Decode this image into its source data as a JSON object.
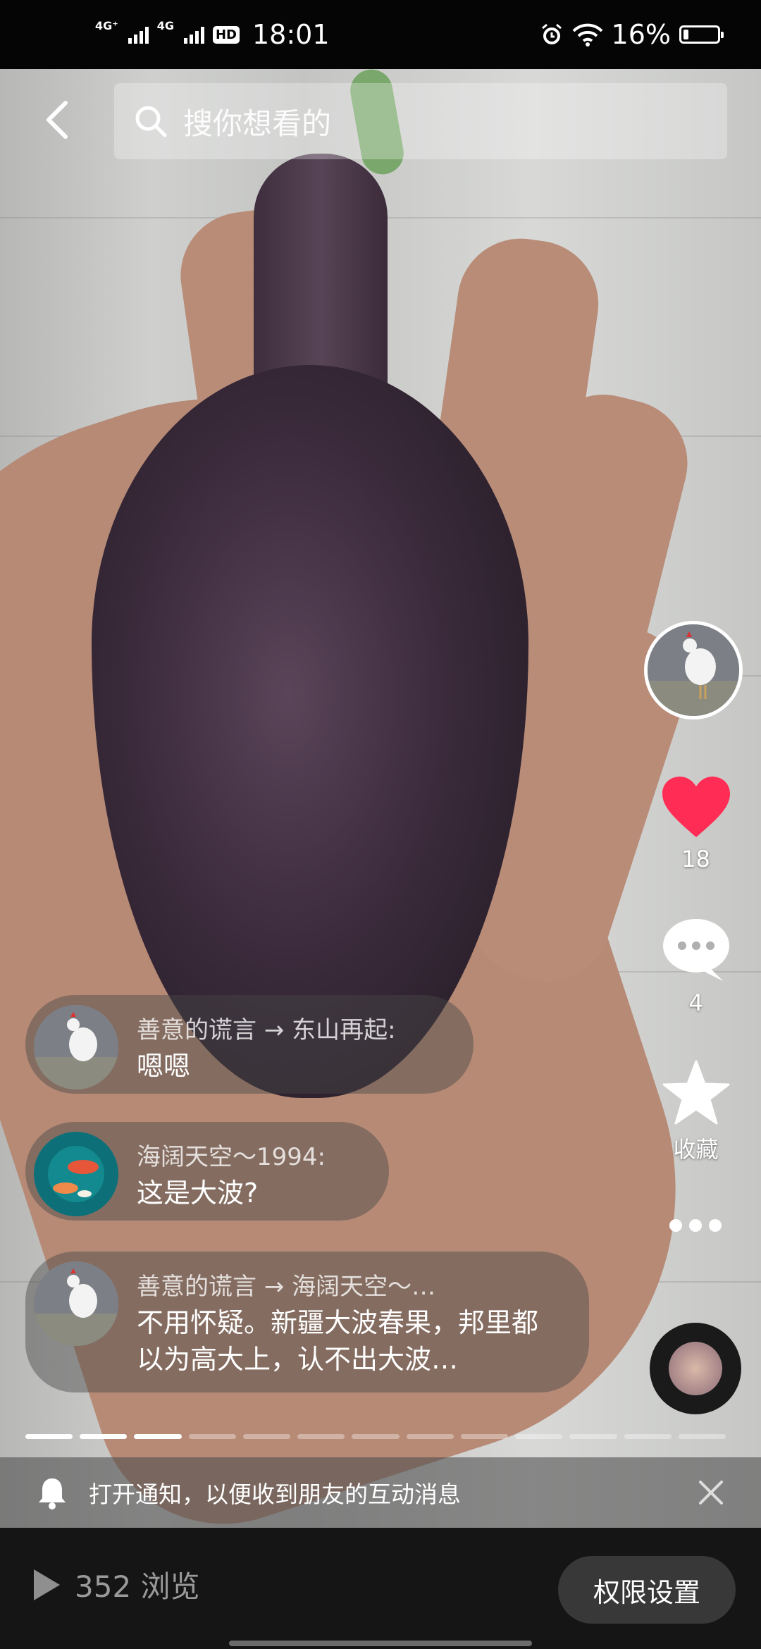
{
  "status_bar": {
    "net1": "4G⁺",
    "net2": "4G",
    "hd": "HD",
    "time": "18:01",
    "battery": "16%"
  },
  "search": {
    "placeholder": "搜你想看的"
  },
  "actions": {
    "like_count": "18",
    "comment_count": "4",
    "favorite_label": "收藏"
  },
  "comments": [
    {
      "name": "善意的谎言 → 东山再起:",
      "text": "嗯嗯"
    },
    {
      "name": "海阔天空～1994:",
      "text": "这是大波?"
    },
    {
      "name": "善意的谎言 → 海阔天空～…",
      "text": "不用怀疑。新疆大波春果，邦里都以为高大上，认不出大波…"
    }
  ],
  "progress": {
    "total_segments": 13,
    "active_segments": 3
  },
  "notice": {
    "text": "打开通知，以便收到朋友的互动消息"
  },
  "bottom": {
    "views": "352 浏览",
    "permission_button": "权限设置"
  },
  "colors": {
    "like": "#ff2d55",
    "statusbar": "#050505",
    "bottombar": "#151515"
  }
}
